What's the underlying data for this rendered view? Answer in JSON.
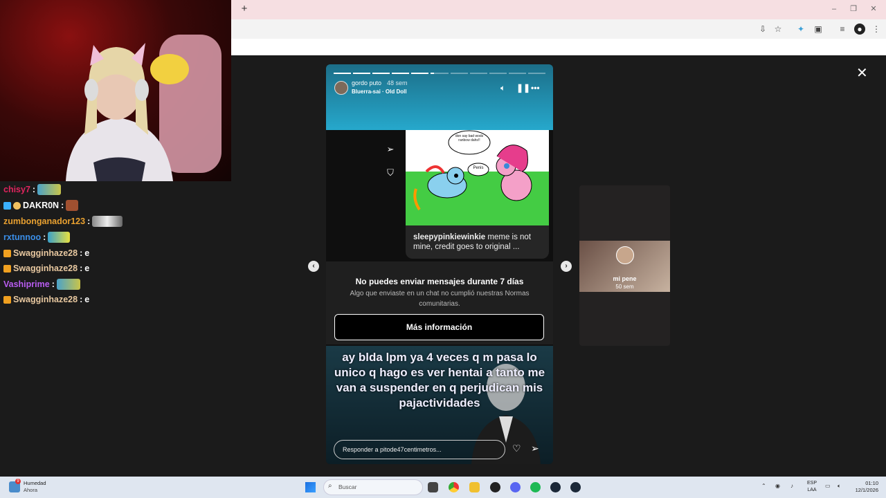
{
  "browser": {
    "new_tab_label": "+",
    "window_minimize": "–",
    "window_restore": "❐",
    "window_close": "✕",
    "toolbar_icons": [
      "install-icon",
      "star-icon",
      "extension-icon",
      "puzzle-icon",
      "media-icon",
      "profile-icon",
      "menu-icon"
    ]
  },
  "chat": [
    {
      "user": "chisy7",
      "sep": " :",
      "message": "",
      "color": "#e0245e",
      "emote": true
    },
    {
      "user": "DAKR0N",
      "sep": " :",
      "message": "",
      "color": "#ffffff",
      "emote": true,
      "badges": [
        "#3ab0ff",
        "#f0c060"
      ]
    },
    {
      "user": "zumbonganador123",
      "sep": " :",
      "message": "",
      "color": "#e8a030",
      "emote": true
    },
    {
      "user": "rxtunnoo",
      "sep": " :",
      "message": "",
      "color": "#3a8ee8",
      "emote": true
    },
    {
      "user": "Swagginhaze28",
      "sep": " :",
      "message": " e",
      "color": "#e8c8a0",
      "badges": [
        "#f0a020"
      ]
    },
    {
      "user": "Swagginhaze28",
      "sep": " :",
      "message": " e",
      "color": "#e8c8a0",
      "badges": [
        "#f0a020"
      ]
    },
    {
      "user": "Vashiprime",
      "sep": " :",
      "message": "",
      "color": "#b85cf0",
      "emote": true
    },
    {
      "user": "Swagginhaze28",
      "sep": " :",
      "message": " e",
      "color": "#e8c8a0",
      "badges": [
        "#f0a020"
      ]
    }
  ],
  "story": {
    "author": "gordo puto",
    "time": "48 sem",
    "music": "Bluerra-sai · Old Doll",
    "progress_segments": 11,
    "progress_done": 5,
    "progress_current_fraction": 0.2,
    "bubble_top": "don say bad wods ranbow dahs!!",
    "bubble_mid": "Penis",
    "caption_user": "sleepypinkiewinkie",
    "caption_text": " meme is not mine, credit goes to original ...",
    "notice_title": "No puedes enviar mensajes durante 7 días",
    "notice_body": "Algo que enviaste en un chat no cumplió nuestras Normas comunitarias.",
    "more_button": "Más información",
    "video_text": "ay blda lpm ya 4 veces q m pasa lo unico q hago es ver hentai a tanto me van a suspender en q perjudican mis pajactividades",
    "reply_placeholder": "Responder a pitode47centimetros..."
  },
  "next_story": {
    "name": "mi pene",
    "time": "50 sem"
  },
  "taskbar": {
    "weather_title": "Humedad",
    "weather_sub": "Ahora",
    "weather_badge": "9",
    "search_placeholder": "Buscar",
    "lang_top": "ESP",
    "lang_bottom": "LAA",
    "time": "01:10",
    "date": "12/1/2026"
  }
}
